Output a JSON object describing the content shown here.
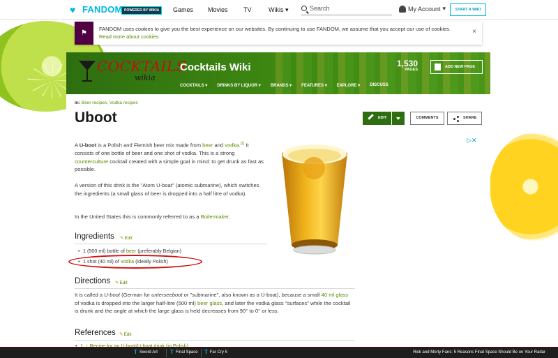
{
  "global_nav": {
    "brand": "FANDOM",
    "powered_by": "POWERED BY WIKIA",
    "links": [
      "Games",
      "Movies",
      "TV",
      "Wikis"
    ],
    "wikis_caret": "▾",
    "search_placeholder": "Search",
    "account_label": "My Account",
    "account_caret": "▾",
    "start_wiki": "START A WIKI"
  },
  "cookie_banner": {
    "text": "FANDOM uses cookies to give you the best experience on our websites. By continuing to use FANDOM, we assume that you accept our use of cookies.",
    "link": "Read more about cookies",
    "close": "×"
  },
  "wiki_header": {
    "logo_text": "COCKTAILS",
    "logo_sub": "wikia",
    "title": "Cocktails Wiki",
    "nav": [
      "COCKTAILS ▾",
      "DRINKS BY LIQUOR ▾",
      "BRANDS ▾",
      "FEATURES ▾",
      "EXPLORE ▾",
      "DISCUSS"
    ],
    "pages_count": "1,530",
    "pages_label": "PAGES",
    "add_page": "ADD NEW PAGE"
  },
  "article": {
    "categories_prefix": "in:",
    "categories": "Beer recipes, Vodka recipes",
    "title": "Uboot",
    "edit_label": "EDIT",
    "comments_label": "COMMENTS",
    "share_label": "SHARE",
    "ad_close": "▷✕",
    "intro": {
      "p1_a": "A ",
      "p1_bold": "U-boot",
      "p1_b": " is a Polish and Flemish beer mix made from ",
      "p1_beer": "beer",
      "p1_and": " and ",
      "p1_vodka": "vodka",
      "p1_ref": "[1]",
      "p1_it": " It consists of one bottle of beer and one shot of vodka. This is a strong ",
      "p1_counter": "counterculture",
      "p1_c": " cocktail created with a simple goal in mind: to get drunk as fast as possible.",
      "p2": "A version of this drink is the \"Atom U-boat\" (atomic submarine), which switches the ingredients (a small glass of beer is dropped into a half litre of vodka).",
      "p3_a": "In the United States this is commonly referred to as a ",
      "p3_link": "Boilermaker",
      "p3_b": "."
    },
    "ingredients": {
      "heading": "Ingredients",
      "edit": "Edit",
      "item1_a": "1 (500 ml) bottle of ",
      "item1_link": "beer",
      "item1_b": " (preferably Belgian)",
      "item2_a": "1 shot (40 ml) of ",
      "item2_link": "vodka",
      "item2_b": " (ideally Polish)"
    },
    "directions": {
      "heading": "Directions",
      "edit": "Edit",
      "a": "It is called a ",
      "uboot": "U-boot",
      "b": " (German for ",
      "unter": "unterseeboot",
      "c": " or \"submarine\", also known as a U-boat), because a small ",
      "glass_link": "40 ml glass",
      "d": " of vodka is dropped into the larger half-litre (500 ml) ",
      "beerglass_link": "beer glass",
      "e": ", and later the vodka glass \"surfaces\" while the cocktail is drunk and the angle at which the large glass is held decreases from 90° to 0° or less."
    },
    "references": {
      "heading": "References",
      "edit": "Edit",
      "item1": "1. ↑ Recipe for an U-boot/U-boat drink (in Polish)"
    }
  },
  "toolbar": {
    "items": [
      "Sword Art",
      "Final Space",
      "Far Cry 5"
    ],
    "news": "Rick and Morty Fans: 5 Reasons Final Space Should Be on Your Radar"
  },
  "colors": {
    "fandom_blue": "#00b7e0",
    "wiki_green": "#2e6e10",
    "link_green": "#5a8a00",
    "annotation_red": "#d01010"
  }
}
